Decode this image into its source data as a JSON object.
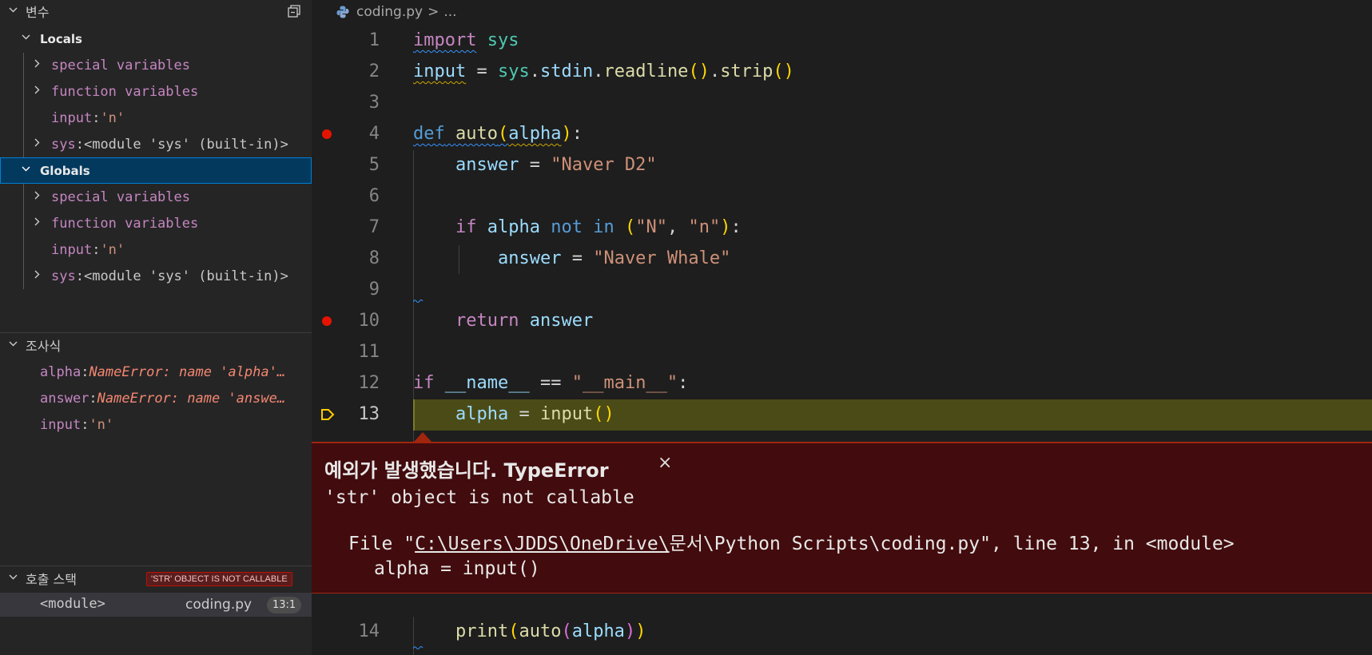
{
  "variables": {
    "title": "변수",
    "locals": {
      "label": "Locals",
      "items": [
        {
          "name": "special variables"
        },
        {
          "name": "function variables"
        },
        {
          "name": "input",
          "value": "'n'"
        },
        {
          "name": "sys",
          "value": "<module 'sys' (built-in)>"
        }
      ]
    },
    "globals": {
      "label": "Globals",
      "items": [
        {
          "name": "special variables"
        },
        {
          "name": "function variables"
        },
        {
          "name": "input",
          "value": "'n'"
        },
        {
          "name": "sys",
          "value": "<module 'sys' (built-in)>"
        }
      ]
    }
  },
  "watch": {
    "title": "조사식",
    "items": [
      {
        "name": "alpha",
        "value": "NameError: name 'alpha'…"
      },
      {
        "name": "answer",
        "value": "NameError: name 'answe…"
      },
      {
        "name": "input",
        "value": "'n'"
      }
    ]
  },
  "callstack": {
    "title": "호출 스택",
    "badge": "'STR' OBJECT IS NOT CALLABLE",
    "frame": {
      "name": "<module>",
      "file": "coding.py",
      "pos": "13:1"
    }
  },
  "editor": {
    "breadcrumb": {
      "file": "coding.py",
      "sep": ">",
      "rest": "..."
    },
    "line_numbers": [
      "1",
      "2",
      "3",
      "4",
      "5",
      "6",
      "7",
      "8",
      "9",
      "10",
      "11",
      "12",
      "13",
      "14"
    ],
    "tokens": {
      "l1": [
        "import",
        "sys"
      ],
      "l2": [
        "input",
        "=",
        "sys",
        ".",
        "stdin",
        ".",
        "readline",
        "(",
        ")",
        ".",
        "strip",
        "(",
        ")"
      ],
      "l4": [
        "def",
        "auto",
        "(",
        "alpha",
        ")",
        ":"
      ],
      "l5": [
        "answer",
        "=",
        "\"Naver D2\""
      ],
      "l7": [
        "if",
        "alpha",
        "not",
        "in",
        "(",
        "\"N\"",
        ",",
        "\"n\"",
        ")",
        ":"
      ],
      "l8": [
        "answer",
        "=",
        "\"Naver Whale\""
      ],
      "l10": [
        "return",
        "answer"
      ],
      "l12": [
        "if",
        "__name__",
        "==",
        "\"__main__\"",
        ":"
      ],
      "l13": [
        "alpha",
        "=",
        "input",
        "(",
        ")"
      ],
      "l14": [
        "print",
        "(",
        "auto",
        "(",
        "alpha",
        ")",
        ")"
      ]
    }
  },
  "exception": {
    "title": "예외가 발생했습니다. TypeError",
    "close": "×",
    "message": "'str' object is not callable",
    "trace_prefix": "File \"",
    "trace_path": "C:\\Users\\JDDS\\OneDrive\\",
    "trace_rest": "문서\\Python Scripts\\coding.py\", line 13, in <module>",
    "trace_code": "alpha = input()"
  },
  "colors": {
    "breakpoint": "#e51400",
    "current_line": "#4b4b18",
    "exception_bg": "#420b0d",
    "selection": "#04395e"
  }
}
